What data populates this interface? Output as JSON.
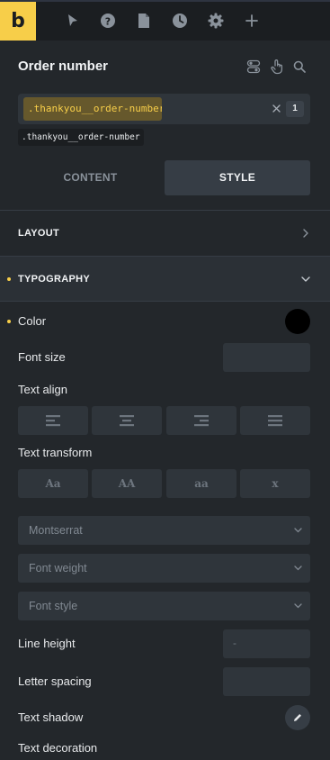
{
  "app": {
    "logo_letter": "b"
  },
  "toolbar": {
    "icons": [
      "cursor-icon",
      "help-icon",
      "page-icon",
      "history-icon",
      "settings-icon",
      "add-icon"
    ]
  },
  "panel": {
    "title": "Order number",
    "header_icons": [
      "toggle-icon",
      "pointer-hand-icon",
      "search-icon"
    ]
  },
  "selector": {
    "active_selector": ".thankyou__order-number",
    "count": "1",
    "class_tag": ".thankyou__order-number"
  },
  "tabs": [
    {
      "label": "CONTENT",
      "active": false
    },
    {
      "label": "STYLE",
      "active": true
    }
  ],
  "sections": {
    "layout": {
      "title": "LAYOUT",
      "expanded": false
    },
    "typography": {
      "title": "TYPOGRAPHY",
      "expanded": true
    }
  },
  "typography": {
    "color": {
      "label": "Color",
      "value": "#000000"
    },
    "font_size": {
      "label": "Font size",
      "value": ""
    },
    "text_align": {
      "label": "Text align",
      "options": [
        "align-left-icon",
        "align-center-icon",
        "align-right-icon",
        "align-justify-icon"
      ]
    },
    "text_transform": {
      "label": "Text transform",
      "options": [
        "Aa",
        "AA",
        "aa",
        "x"
      ]
    },
    "font_family": {
      "value": "Montserrat"
    },
    "font_weight": {
      "placeholder": "Font weight"
    },
    "font_style": {
      "placeholder": "Font style"
    },
    "line_height": {
      "label": "Line height",
      "placeholder": "-"
    },
    "letter_spacing": {
      "label": "Letter spacing",
      "value": ""
    },
    "text_shadow": {
      "label": "Text shadow"
    },
    "text_decoration": {
      "label": "Text decoration"
    }
  },
  "colors": {
    "accent": "#f7ce49",
    "panel_bg": "#23272b",
    "topbar_bg": "#1b1e21",
    "control_bg": "#2f353b"
  }
}
